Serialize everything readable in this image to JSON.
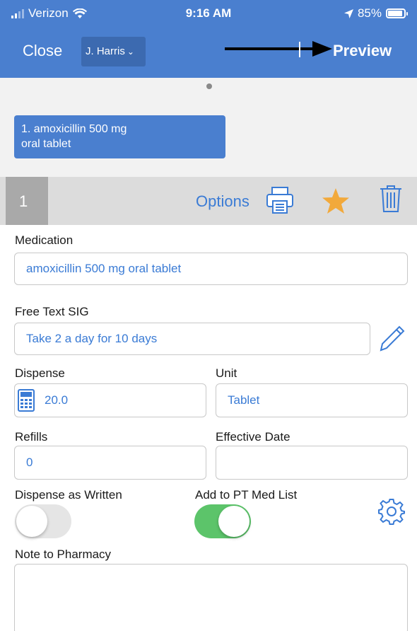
{
  "status_bar": {
    "carrier": "Verizon",
    "time": "9:16 AM",
    "battery": "85%",
    "battery_level": 0.85
  },
  "nav": {
    "close_label": "Close",
    "provider": "J. Harris",
    "preview_label": "Preview"
  },
  "page_indicator": {
    "count": 1,
    "active": 0
  },
  "prescription_tab": {
    "line1": "1. amoxicillin 500 mg",
    "line2": "oral tablet"
  },
  "toolbar": {
    "rx_number": "1",
    "options_label": "Options",
    "icons": [
      "printer-icon",
      "star-icon",
      "trash-icon"
    ]
  },
  "form": {
    "medication": {
      "label": "Medication",
      "value": "amoxicillin 500 mg oral tablet"
    },
    "sig": {
      "label": "Free Text SIG",
      "value": "Take 2 a day for 10 days"
    },
    "dispense": {
      "label": "Dispense",
      "value": "20.0"
    },
    "unit": {
      "label": "Unit",
      "value": "Tablet"
    },
    "refills": {
      "label": "Refills",
      "value": "0"
    },
    "effective_date": {
      "label": "Effective Date",
      "value": ""
    },
    "dispense_as_written": {
      "label": "Dispense as Written",
      "on": false
    },
    "add_to_pt_med_list": {
      "label": "Add to PT Med List",
      "on": true
    },
    "note_to_pharmacy": {
      "label": "Note to Pharmacy",
      "value": ""
    }
  },
  "colors": {
    "header": "#4a7fcf",
    "link": "#3a7bd5",
    "star": "#f2a93b",
    "toggle_on": "#5cc46a",
    "toggle_off": "#e5e5e5"
  }
}
